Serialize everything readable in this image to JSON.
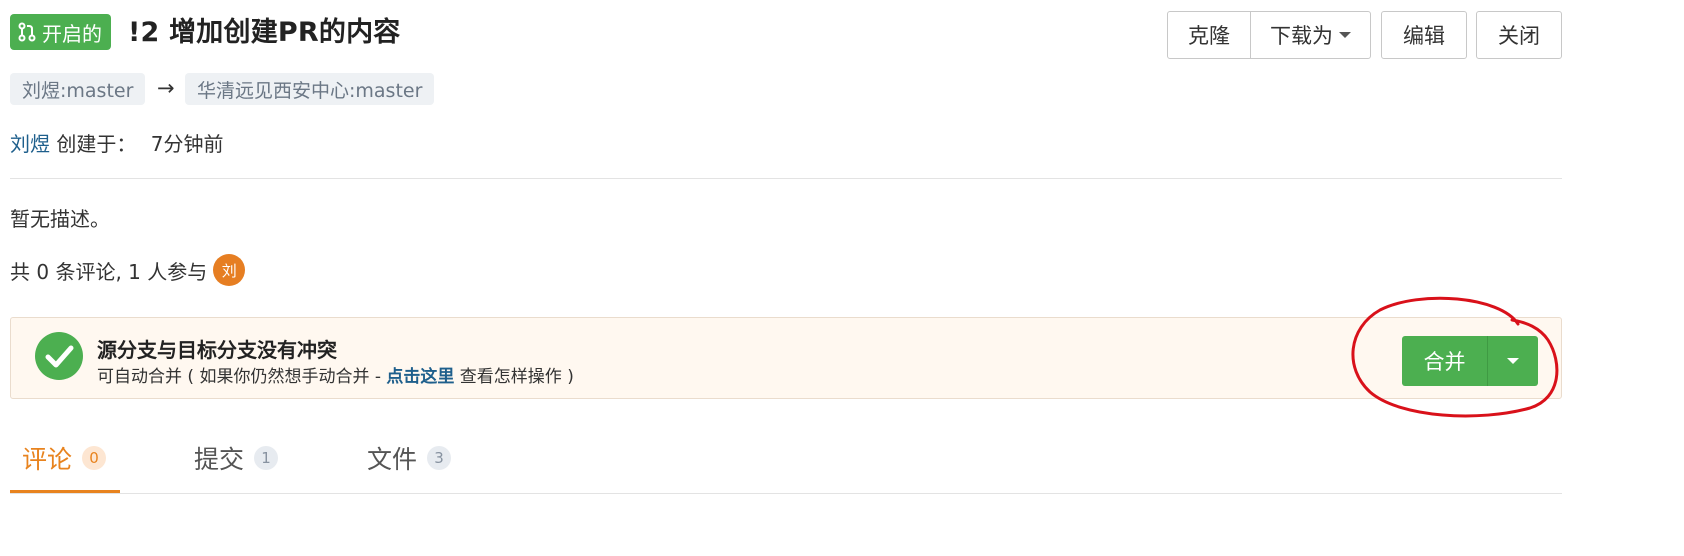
{
  "header": {
    "state_label": "开启的",
    "title": "!2 增加创建PR的内容",
    "buttons": {
      "clone": "克隆",
      "download": "下载为",
      "edit": "编辑",
      "close": "关闭"
    }
  },
  "branches": {
    "source": "刘煜:master",
    "arrow": "→",
    "target": "华清远见西安中心:master"
  },
  "meta": {
    "author": "刘煜",
    "created_label": "创建于：",
    "created_time": "7分钟前"
  },
  "description": "暂无描述。",
  "stats": {
    "text": "共 0 条评论, 1 人参与",
    "avatar_initial": "刘"
  },
  "merge": {
    "title": "源分支与目标分支没有冲突",
    "sub_prefix": "可自动合并 ( 如果你仍然想手动合并 - ",
    "sub_link": "点击这里",
    "sub_suffix": " 查看怎样操作 )",
    "button": "合并"
  },
  "tabs": [
    {
      "label": "评论",
      "count": "0"
    },
    {
      "label": "提交",
      "count": "1"
    },
    {
      "label": "文件",
      "count": "3"
    }
  ],
  "colors": {
    "accent_green": "#4caf50",
    "accent_orange": "#e8831e",
    "link_blue": "#1e5f8c",
    "annotation_red": "#d9111a"
  }
}
